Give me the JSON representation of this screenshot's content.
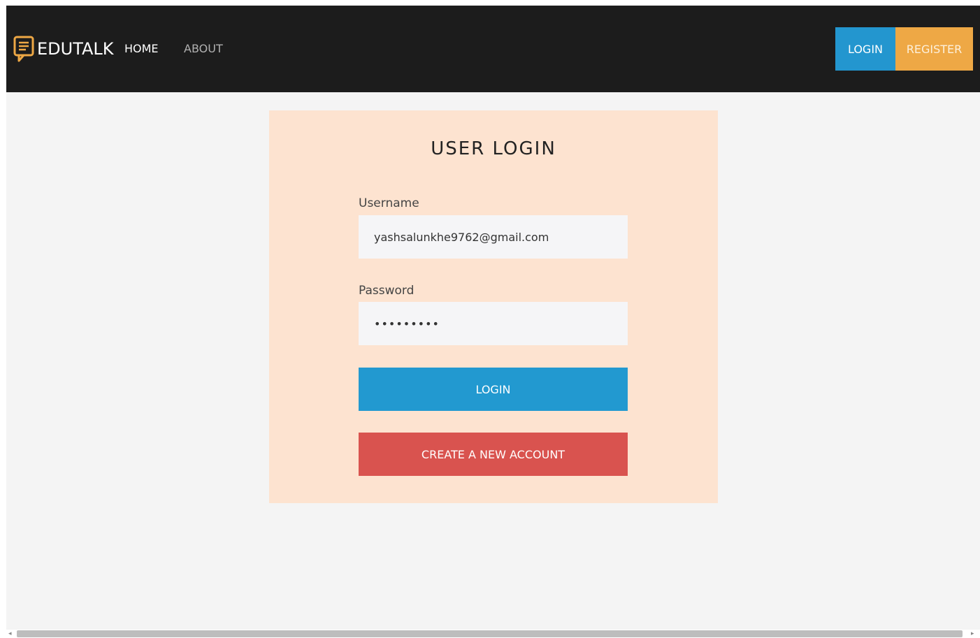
{
  "colors": {
    "navbar_bg": "#1c1c1c",
    "page_bg": "#f4f4f4",
    "card_bg": "#fde3d0",
    "login_blue": "#2299d0",
    "register_orange": "#eea845",
    "create_red": "#d9534f",
    "brand_icon": "#eea845"
  },
  "navbar": {
    "brand": {
      "icon": "chat-message-icon",
      "name": "EDUTALK"
    },
    "links": {
      "home": "HOME",
      "about": "ABOUT"
    },
    "buttons": {
      "login": "LOGIN",
      "register": "REGISTER"
    }
  },
  "login_card": {
    "title": "USER LOGIN",
    "username": {
      "label": "Username",
      "value": "yashsalunkhe9762@gmail.com"
    },
    "password": {
      "label": "Password",
      "value": "•••••••••"
    },
    "login_button": "LOGIN",
    "create_account_button": "CREATE A NEW ACCOUNT"
  },
  "scrollbar": {
    "left_arrow_icon": "arrow-left-icon",
    "right_arrow_icon": "arrow-right-icon"
  }
}
